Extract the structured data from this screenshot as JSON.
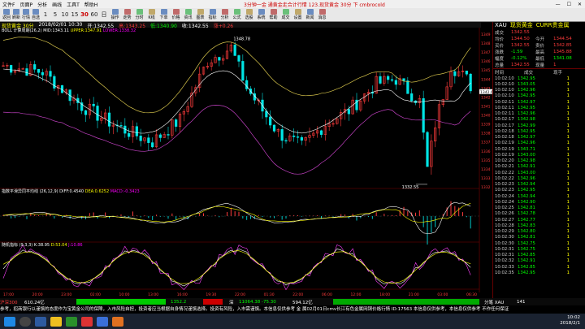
{
  "menubar": {
    "items": [
      "文件F",
      "页面P",
      "分析",
      "画线",
      "工具T",
      "帮助H"
    ],
    "title": "3分钟一金 通黄金走合计行情 123.现货黄金 30分 下 cmbrocold"
  },
  "toolbar": {
    "periods": [
      "1",
      "5",
      "10",
      "15",
      "30",
      "60",
      "日"
    ],
    "active_period": "30",
    "tool_labels": [
      "返回",
      "刷新",
      "行情",
      "自选",
      "操作",
      "走势",
      "分时",
      "K线",
      "下单",
      "价格",
      "资讯",
      "图表",
      "指标",
      "分析",
      "公式",
      "选股",
      "系统",
      "帮助",
      "成交",
      "设置",
      "新闻",
      "消息"
    ]
  },
  "chart_tab": {
    "symbol_label": "现货黄金 30分",
    "date": "2018/02/01 10:30",
    "open": "开:1342.55",
    "high": "高:1343.25",
    "low": "低:1340.90",
    "close": "收:1342.55",
    "change": "涨+0.26"
  },
  "boll_info": {
    "name": "BOLL 计算周期(26,2)",
    "mid": "MID:1343.11",
    "upper": "UPPER:1347.91",
    "lower": "LOWER:1338.32"
  },
  "macd_info": {
    "name": "指数平滑异同平均线 (26,12,9)",
    "diff": "DIFF:0.4540",
    "dea": "DEA:0.6252",
    "macd": "MACD:-0.3423"
  },
  "kdj_info": {
    "name": "随机指标 (9,3,3)",
    "k": "K:38.95",
    "d": "D:53.04",
    "j": "J:10.86"
  },
  "annotations": {
    "high": "1348.78",
    "low": "1332.55"
  },
  "price_axis": [
    "1349",
    "1348",
    "1347",
    "1346",
    "1345",
    "1344",
    "1343",
    "1342",
    "1341",
    "1340",
    "1339",
    "1338",
    "1337",
    "1336",
    "1335",
    "1334",
    "1333",
    "1332"
  ],
  "current_price_tag": "1342.6",
  "time_axis": [
    "17:00",
    "20:00",
    "23:00",
    "02:00",
    "10:00",
    "13:00",
    "16:00",
    "19:30",
    "22:00",
    "01:30",
    "22:00",
    "06:00",
    "12:00",
    "18:00",
    "21:00",
    "03:00",
    "06:30"
  ],
  "quote": {
    "symbol": "XAU",
    "name": "现货黄金",
    "exchange": "CURR贵金属",
    "rows": [
      {
        "k": "成交",
        "v": "1342.55",
        "k2": "",
        "v2": ""
      },
      {
        "k": "均价",
        "v": "1344.50",
        "k2": "今开",
        "v2": "1344.54"
      },
      {
        "k": "买价",
        "v": "1342.55",
        "k2": "卖价",
        "v2": "1342.85"
      },
      {
        "k": "涨跌",
        "v": "-1.59",
        "k2": "最高",
        "v2": "1345.88"
      },
      {
        "k": "幅度",
        "v": "-0.12%",
        "k2": "最低",
        "v2": "1341.08"
      },
      {
        "k": "总量",
        "v": "1342.55",
        "k2": "现量",
        "v2": "1"
      }
    ],
    "tick_header": [
      "时间",
      "成交",
      "现手"
    ],
    "ticks": [
      [
        "10:02:10",
        "1342.95",
        "1"
      ],
      [
        "10:02:10",
        "1343.05",
        "1"
      ],
      [
        "10:02:10",
        "1342.96",
        "1"
      ],
      [
        "10:02:10",
        "1342.95",
        "1"
      ],
      [
        "10:02:11",
        "1342.97",
        "1"
      ],
      [
        "10:02:11",
        "1342.95",
        "1"
      ],
      [
        "10:02:11",
        "1342.96",
        "1"
      ],
      [
        "10:02:17",
        "1342.98",
        "1"
      ],
      [
        "10:02:17",
        "1342.99",
        "1"
      ],
      [
        "10:02:18",
        "1342.95",
        "1"
      ],
      [
        "10:02:18",
        "1342.97",
        "1"
      ],
      [
        "10:02:19",
        "1342.96",
        "1"
      ],
      [
        "10:02:19",
        "1343.71",
        "1"
      ],
      [
        "10:02:19",
        "1343.00",
        "1"
      ],
      [
        "10:02:20",
        "1342.98",
        "1"
      ],
      [
        "10:02:21",
        "1342.91",
        "1"
      ],
      [
        "10:02:22",
        "1343.00",
        "1"
      ],
      [
        "10:02:22",
        "1342.96",
        "1"
      ],
      [
        "10:02:23",
        "1342.94",
        "1"
      ],
      [
        "10:02:23",
        "1342.95",
        "1"
      ],
      [
        "10:02:24",
        "1342.94",
        "1"
      ],
      [
        "10:02:24",
        "1342.90",
        "1"
      ],
      [
        "10:02:25",
        "1342.81",
        "1"
      ],
      [
        "10:02:26",
        "1342.78",
        "1"
      ],
      [
        "10:02:27",
        "1342.77",
        "1"
      ],
      [
        "10:02:28",
        "1342.83",
        "1"
      ],
      [
        "10:02:29",
        "1342.80",
        "1"
      ],
      [
        "10:02:30",
        "1342.81",
        "1"
      ],
      [
        "10:02:30",
        "1342.75",
        "1"
      ],
      [
        "10:02:31",
        "1342.75",
        "1"
      ],
      [
        "10:02:31",
        "1342.85",
        "1"
      ],
      [
        "10:02:32",
        "1342.91",
        "1"
      ],
      [
        "10:02:33",
        "1342.85",
        "1"
      ],
      [
        "10:02:35",
        "1342.95",
        "1"
      ]
    ]
  },
  "status_bar": {
    "left_code": "沪深300",
    "left_val": "610.24亿",
    "mid1": "1352.2",
    "mid_code": "深",
    "mid_val": "11064.38  -75.30",
    "mid_amt": "594.12亿",
    "right_code": "分笔 XAU",
    "right_val": "141"
  },
  "ticker_text": "参考，招商银行以谨慎的态度作为宝黄金公司的保障，入市风险自担，投资者应当根据自身情况谨慎选择。投资有风险，入市需谨慎。本信息仅供参考  金  属02月01日cmv长江有色金属网铜价格行情 ID:17563  本信息仅供参考，本信息仅供参考  不作任何保证",
  "clock": {
    "time": "10:02",
    "date": "2018/2/1"
  },
  "colors": {
    "up": "#ff3b3b",
    "down": "#00e5e5",
    "boll_band": "#d4c24a",
    "boll_mid": "#ffffff",
    "boll_lower": "#c040c0",
    "dif": "#ffffff",
    "dea": "#ffff00",
    "k": "#ffffff",
    "d": "#ffff00",
    "j": "#ff40ff"
  }
}
